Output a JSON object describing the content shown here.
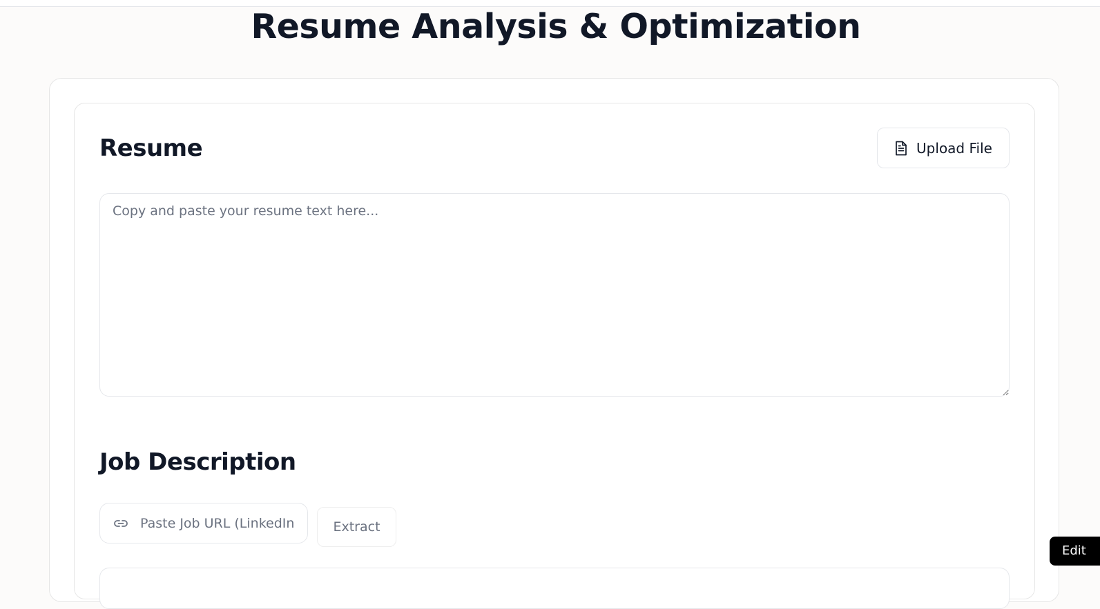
{
  "page": {
    "title": "Resume Analysis & Optimization"
  },
  "resume": {
    "heading": "Resume",
    "upload_button": {
      "label": "Upload File",
      "icon": "file-text-icon"
    },
    "textarea": {
      "placeholder": "Copy and paste your resume text here...",
      "value": ""
    }
  },
  "job_description": {
    "heading": "Job Description",
    "url_input": {
      "icon": "link-icon",
      "placeholder": "Paste Job URL (LinkedIn",
      "value": ""
    },
    "extract_button": {
      "label": "Extract"
    }
  },
  "floating": {
    "edit_label": "Edit"
  },
  "colors": {
    "text_primary": "#111827",
    "text_muted": "#6b7280",
    "border": "#e5e7eb",
    "background": "#fcfbfa",
    "edit_button_bg": "#000000"
  }
}
